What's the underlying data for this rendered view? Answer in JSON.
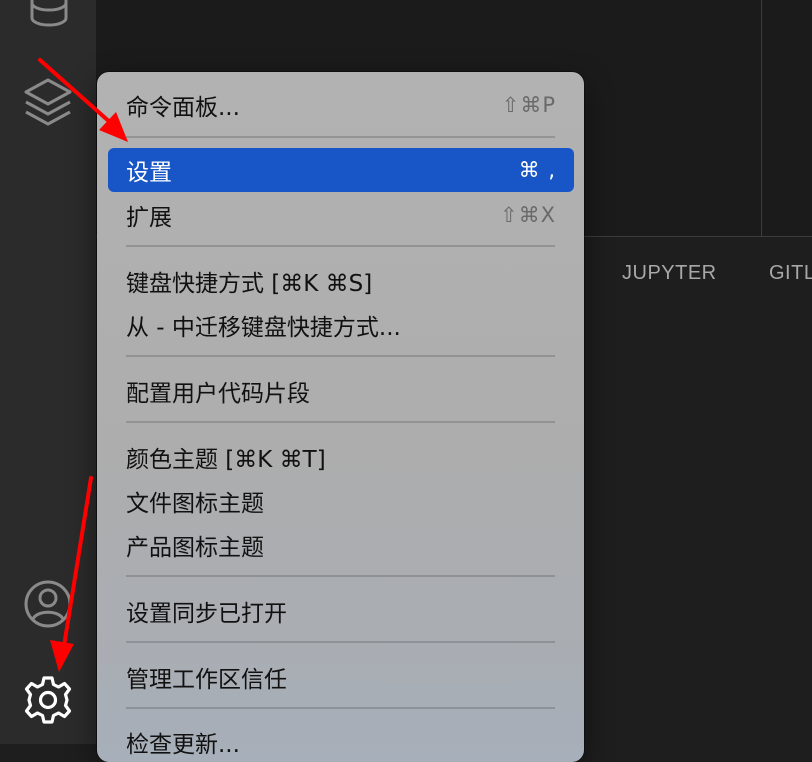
{
  "activity_bar": {
    "icons": [
      "database-icon",
      "layers-icon",
      "account-icon",
      "settings-gear-icon"
    ]
  },
  "panel": {
    "tabs": [
      "JUPYTER",
      "GITL"
    ]
  },
  "context_menu": {
    "items": [
      {
        "label": "命令面板...",
        "shortcut": "⇧⌘P"
      },
      {
        "label": "设置",
        "shortcut": "⌘ ,",
        "selected": true
      },
      {
        "label": "扩展",
        "shortcut": "⇧⌘X"
      },
      {
        "label": "键盘快捷方式 [⌘K ⌘S]",
        "shortcut": ""
      },
      {
        "label": "从 - 中迁移键盘快捷方式...",
        "shortcut": ""
      },
      {
        "label": "配置用户代码片段",
        "shortcut": ""
      },
      {
        "label": "颜色主题 [⌘K ⌘T]",
        "shortcut": ""
      },
      {
        "label": "文件图标主题",
        "shortcut": ""
      },
      {
        "label": "产品图标主题",
        "shortcut": ""
      },
      {
        "label": "设置同步已打开",
        "shortcut": ""
      },
      {
        "label": "管理工作区信任",
        "shortcut": ""
      },
      {
        "label": "检查更新...",
        "shortcut": ""
      }
    ]
  },
  "annotations": {
    "arrow_color": "#ff0000"
  },
  "colors": {
    "selection": "#1856c8",
    "menu_background": "#b0b0b0",
    "activity_bar": "#2b2b2b",
    "editor_background": "#1e1e1e"
  }
}
